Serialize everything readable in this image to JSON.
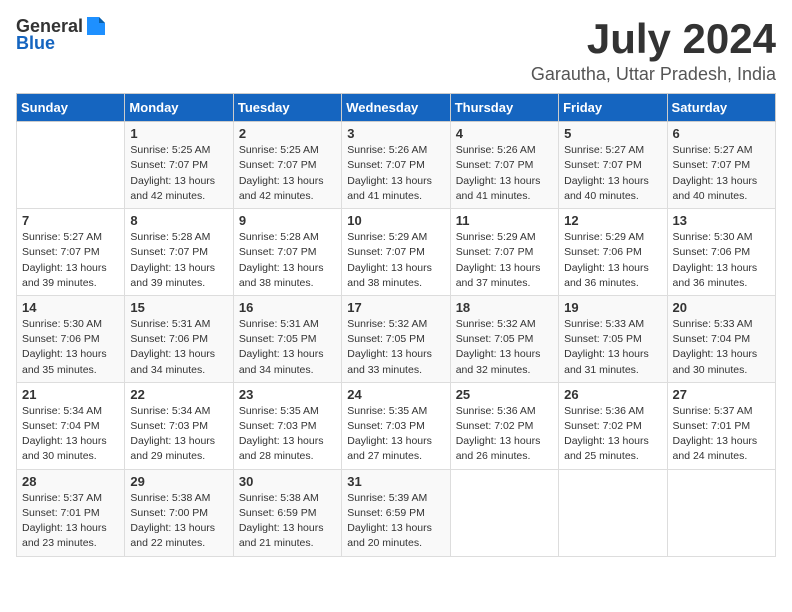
{
  "header": {
    "logo_general": "General",
    "logo_blue": "Blue",
    "month_year": "July 2024",
    "location": "Garautha, Uttar Pradesh, India"
  },
  "days_of_week": [
    "Sunday",
    "Monday",
    "Tuesday",
    "Wednesday",
    "Thursday",
    "Friday",
    "Saturday"
  ],
  "weeks": [
    [
      {
        "num": "",
        "sunrise": "",
        "sunset": "",
        "daylight": ""
      },
      {
        "num": "1",
        "sunrise": "Sunrise: 5:25 AM",
        "sunset": "Sunset: 7:07 PM",
        "daylight": "Daylight: 13 hours and 42 minutes."
      },
      {
        "num": "2",
        "sunrise": "Sunrise: 5:25 AM",
        "sunset": "Sunset: 7:07 PM",
        "daylight": "Daylight: 13 hours and 42 minutes."
      },
      {
        "num": "3",
        "sunrise": "Sunrise: 5:26 AM",
        "sunset": "Sunset: 7:07 PM",
        "daylight": "Daylight: 13 hours and 41 minutes."
      },
      {
        "num": "4",
        "sunrise": "Sunrise: 5:26 AM",
        "sunset": "Sunset: 7:07 PM",
        "daylight": "Daylight: 13 hours and 41 minutes."
      },
      {
        "num": "5",
        "sunrise": "Sunrise: 5:27 AM",
        "sunset": "Sunset: 7:07 PM",
        "daylight": "Daylight: 13 hours and 40 minutes."
      },
      {
        "num": "6",
        "sunrise": "Sunrise: 5:27 AM",
        "sunset": "Sunset: 7:07 PM",
        "daylight": "Daylight: 13 hours and 40 minutes."
      }
    ],
    [
      {
        "num": "7",
        "sunrise": "Sunrise: 5:27 AM",
        "sunset": "Sunset: 7:07 PM",
        "daylight": "Daylight: 13 hours and 39 minutes."
      },
      {
        "num": "8",
        "sunrise": "Sunrise: 5:28 AM",
        "sunset": "Sunset: 7:07 PM",
        "daylight": "Daylight: 13 hours and 39 minutes."
      },
      {
        "num": "9",
        "sunrise": "Sunrise: 5:28 AM",
        "sunset": "Sunset: 7:07 PM",
        "daylight": "Daylight: 13 hours and 38 minutes."
      },
      {
        "num": "10",
        "sunrise": "Sunrise: 5:29 AM",
        "sunset": "Sunset: 7:07 PM",
        "daylight": "Daylight: 13 hours and 38 minutes."
      },
      {
        "num": "11",
        "sunrise": "Sunrise: 5:29 AM",
        "sunset": "Sunset: 7:07 PM",
        "daylight": "Daylight: 13 hours and 37 minutes."
      },
      {
        "num": "12",
        "sunrise": "Sunrise: 5:29 AM",
        "sunset": "Sunset: 7:06 PM",
        "daylight": "Daylight: 13 hours and 36 minutes."
      },
      {
        "num": "13",
        "sunrise": "Sunrise: 5:30 AM",
        "sunset": "Sunset: 7:06 PM",
        "daylight": "Daylight: 13 hours and 36 minutes."
      }
    ],
    [
      {
        "num": "14",
        "sunrise": "Sunrise: 5:30 AM",
        "sunset": "Sunset: 7:06 PM",
        "daylight": "Daylight: 13 hours and 35 minutes."
      },
      {
        "num": "15",
        "sunrise": "Sunrise: 5:31 AM",
        "sunset": "Sunset: 7:06 PM",
        "daylight": "Daylight: 13 hours and 34 minutes."
      },
      {
        "num": "16",
        "sunrise": "Sunrise: 5:31 AM",
        "sunset": "Sunset: 7:05 PM",
        "daylight": "Daylight: 13 hours and 34 minutes."
      },
      {
        "num": "17",
        "sunrise": "Sunrise: 5:32 AM",
        "sunset": "Sunset: 7:05 PM",
        "daylight": "Daylight: 13 hours and 33 minutes."
      },
      {
        "num": "18",
        "sunrise": "Sunrise: 5:32 AM",
        "sunset": "Sunset: 7:05 PM",
        "daylight": "Daylight: 13 hours and 32 minutes."
      },
      {
        "num": "19",
        "sunrise": "Sunrise: 5:33 AM",
        "sunset": "Sunset: 7:05 PM",
        "daylight": "Daylight: 13 hours and 31 minutes."
      },
      {
        "num": "20",
        "sunrise": "Sunrise: 5:33 AM",
        "sunset": "Sunset: 7:04 PM",
        "daylight": "Daylight: 13 hours and 30 minutes."
      }
    ],
    [
      {
        "num": "21",
        "sunrise": "Sunrise: 5:34 AM",
        "sunset": "Sunset: 7:04 PM",
        "daylight": "Daylight: 13 hours and 30 minutes."
      },
      {
        "num": "22",
        "sunrise": "Sunrise: 5:34 AM",
        "sunset": "Sunset: 7:03 PM",
        "daylight": "Daylight: 13 hours and 29 minutes."
      },
      {
        "num": "23",
        "sunrise": "Sunrise: 5:35 AM",
        "sunset": "Sunset: 7:03 PM",
        "daylight": "Daylight: 13 hours and 28 minutes."
      },
      {
        "num": "24",
        "sunrise": "Sunrise: 5:35 AM",
        "sunset": "Sunset: 7:03 PM",
        "daylight": "Daylight: 13 hours and 27 minutes."
      },
      {
        "num": "25",
        "sunrise": "Sunrise: 5:36 AM",
        "sunset": "Sunset: 7:02 PM",
        "daylight": "Daylight: 13 hours and 26 minutes."
      },
      {
        "num": "26",
        "sunrise": "Sunrise: 5:36 AM",
        "sunset": "Sunset: 7:02 PM",
        "daylight": "Daylight: 13 hours and 25 minutes."
      },
      {
        "num": "27",
        "sunrise": "Sunrise: 5:37 AM",
        "sunset": "Sunset: 7:01 PM",
        "daylight": "Daylight: 13 hours and 24 minutes."
      }
    ],
    [
      {
        "num": "28",
        "sunrise": "Sunrise: 5:37 AM",
        "sunset": "Sunset: 7:01 PM",
        "daylight": "Daylight: 13 hours and 23 minutes."
      },
      {
        "num": "29",
        "sunrise": "Sunrise: 5:38 AM",
        "sunset": "Sunset: 7:00 PM",
        "daylight": "Daylight: 13 hours and 22 minutes."
      },
      {
        "num": "30",
        "sunrise": "Sunrise: 5:38 AM",
        "sunset": "Sunset: 6:59 PM",
        "daylight": "Daylight: 13 hours and 21 minutes."
      },
      {
        "num": "31",
        "sunrise": "Sunrise: 5:39 AM",
        "sunset": "Sunset: 6:59 PM",
        "daylight": "Daylight: 13 hours and 20 minutes."
      },
      {
        "num": "",
        "sunrise": "",
        "sunset": "",
        "daylight": ""
      },
      {
        "num": "",
        "sunrise": "",
        "sunset": "",
        "daylight": ""
      },
      {
        "num": "",
        "sunrise": "",
        "sunset": "",
        "daylight": ""
      }
    ]
  ]
}
